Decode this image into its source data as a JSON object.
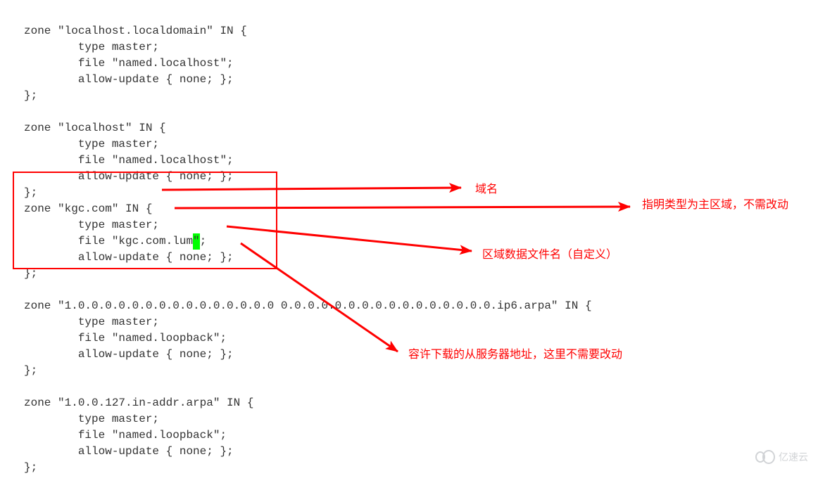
{
  "code_lines": {
    "l0": "zone \"localhost.localdomain\" IN {",
    "l1": "        type master;",
    "l2": "        file \"named.localhost\";",
    "l3": "        allow-update { none; };",
    "l4": "};",
    "l5": "",
    "l6": "zone \"localhost\" IN {",
    "l7": "        type master;",
    "l8": "        file \"named.localhost\";",
    "l9": "        allow-update { none; };",
    "l10": "};",
    "l11_pre": "zone \"kgc.com\" ",
    "l11_strike": "IN {",
    "l12": "        type master;",
    "l13_pre": "        file \"kgc.com.lum",
    "l13_cur": "\"",
    "l13_post": ";",
    "l14": "        allow-update { none; };",
    "l15": "};",
    "l16": "",
    "l17_pre": "zone \"1.0.0.0.0.0.0.0.0.0.0.0.0.0.0.",
    "l17_gap1": "0",
    "l17_mid": " 0.0.0.0.0.0.0.0.0.0.0.0.0.0.0.0.ip6.arpa\" IN {",
    "l18": "        type master;",
    "l19": "        file \"named.loopback\";",
    "l20": "        allow-update { none; };",
    "l21": "};",
    "l22": "",
    "l23": "zone \"1.0.0.127.in-addr.arpa\" IN {",
    "l24": "        type master;",
    "l25": "        file \"named.loopback\";",
    "l26": "        allow-update { none; };",
    "l27": "};"
  },
  "annotations": {
    "domain": "域名",
    "type_master": "指明类型为主区域，不需改动",
    "file_name": "区域数据文件名（自定义）",
    "allow_update": "容许下载的从服务器地址，这里不需要改动"
  },
  "watermark_text": "亿速云"
}
